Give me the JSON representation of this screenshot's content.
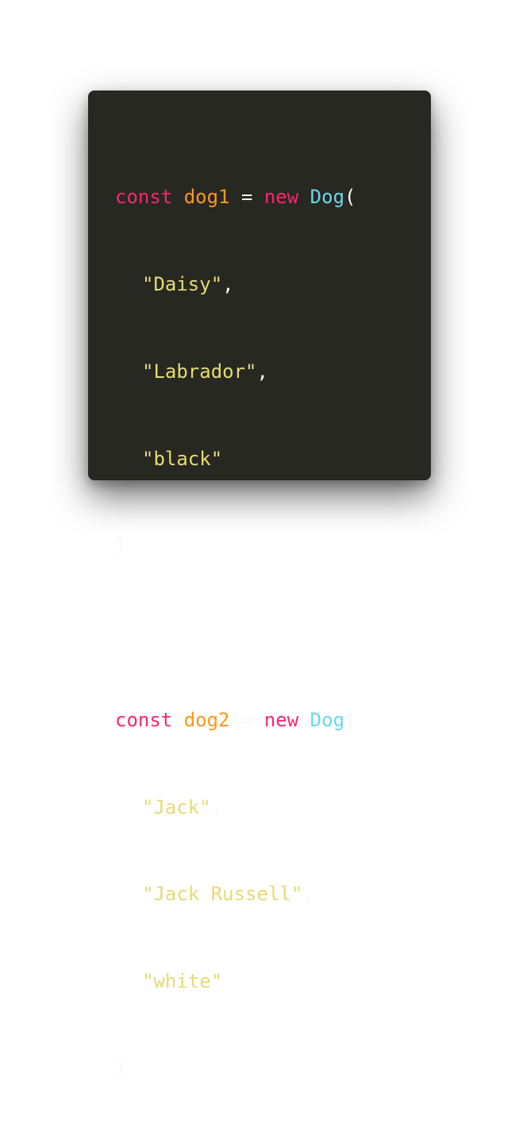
{
  "blocks": [
    {
      "keyword": "const",
      "name": "dog1",
      "op": "=",
      "new": "new",
      "class": "Dog",
      "open": "(",
      "args": [
        "\"Daisy\"",
        "\"Labrador\"",
        "\"black\""
      ],
      "close": ")"
    },
    {
      "keyword": "const",
      "name": "dog2",
      "op": "=",
      "new": "new",
      "class": "Dog",
      "open": "(",
      "args": [
        "\"Jack\"",
        "\"Jack Russell\"",
        "\"white\""
      ],
      "close": ")"
    }
  ],
  "punctuation": {
    "comma": ","
  },
  "theme": {
    "background": "#272822",
    "keyword": "#f92672",
    "variable": "#fd971f",
    "class": "#66d9ef",
    "string": "#e6db74",
    "plain": "#f8f8f2"
  }
}
